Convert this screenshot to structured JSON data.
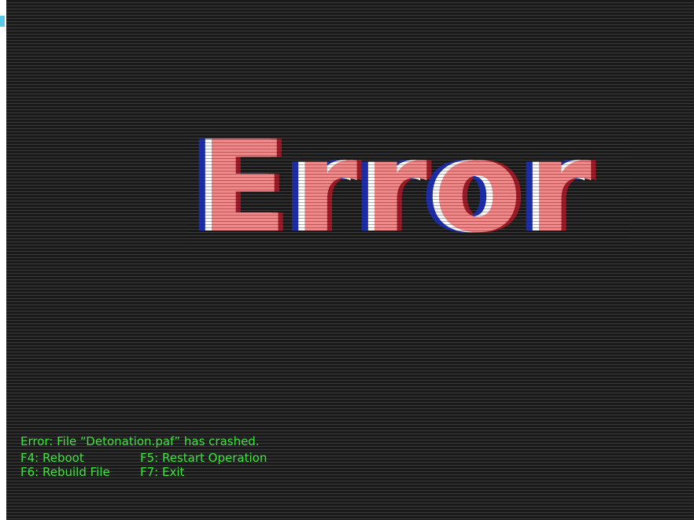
{
  "screen": {
    "title": "Error",
    "colors": {
      "background": "#1b1b1b",
      "scanline": "#3b3b3b",
      "title_fill": "#f08a8a",
      "title_white": "#ffffff",
      "title_blue": "#1f2fa8",
      "title_dark_red": "#9a1f2a",
      "console_text": "#3ee23e",
      "edge_accent": "#5ac8e8"
    }
  },
  "console": {
    "message": "Error: File “Detonation.paf” has crashed.",
    "options": [
      {
        "key": "F4",
        "label": "F4: Reboot"
      },
      {
        "key": "F5",
        "label": "F5: Restart Operation"
      },
      {
        "key": "F6",
        "label": "F6: Rebuild File"
      },
      {
        "key": "F7",
        "label": "F7: Exit"
      }
    ]
  }
}
